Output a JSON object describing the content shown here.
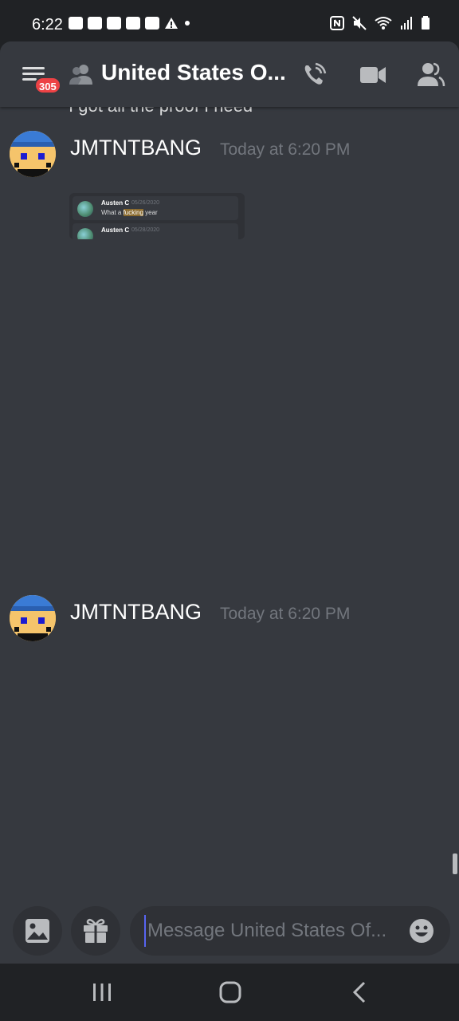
{
  "status_bar": {
    "time": "6:22"
  },
  "header": {
    "menu_icon": "hamburger-menu-icon",
    "badge_count": "305",
    "channel_name": "United States O...",
    "buttons": [
      "call-icon",
      "video-icon",
      "members-icon"
    ]
  },
  "messages": {
    "previous_text": "I got all the proof I need",
    "items": [
      {
        "author": "JMTNTBANG",
        "timestamp": "Today at 6:20 PM",
        "attachment": {
          "rows": [
            {
              "name": "Austen C",
              "date": "05/26/2020",
              "text_before": "What a ",
              "highlight": "fucking",
              "text_after": " year"
            },
            {
              "name": "Austen C",
              "date": "05/28/2020",
              "text_before": "",
              "highlight": "",
              "text_after": ""
            }
          ]
        }
      },
      {
        "author": "JMTNTBANG",
        "timestamp": "Today at 6:20 PM"
      }
    ]
  },
  "composer": {
    "placeholder": "Message United States Of..."
  },
  "colors": {
    "background": "#36393f",
    "secondary": "#2f3136",
    "badge": "#ed4245",
    "accent": "#5865f2",
    "muted": "#72767d"
  }
}
